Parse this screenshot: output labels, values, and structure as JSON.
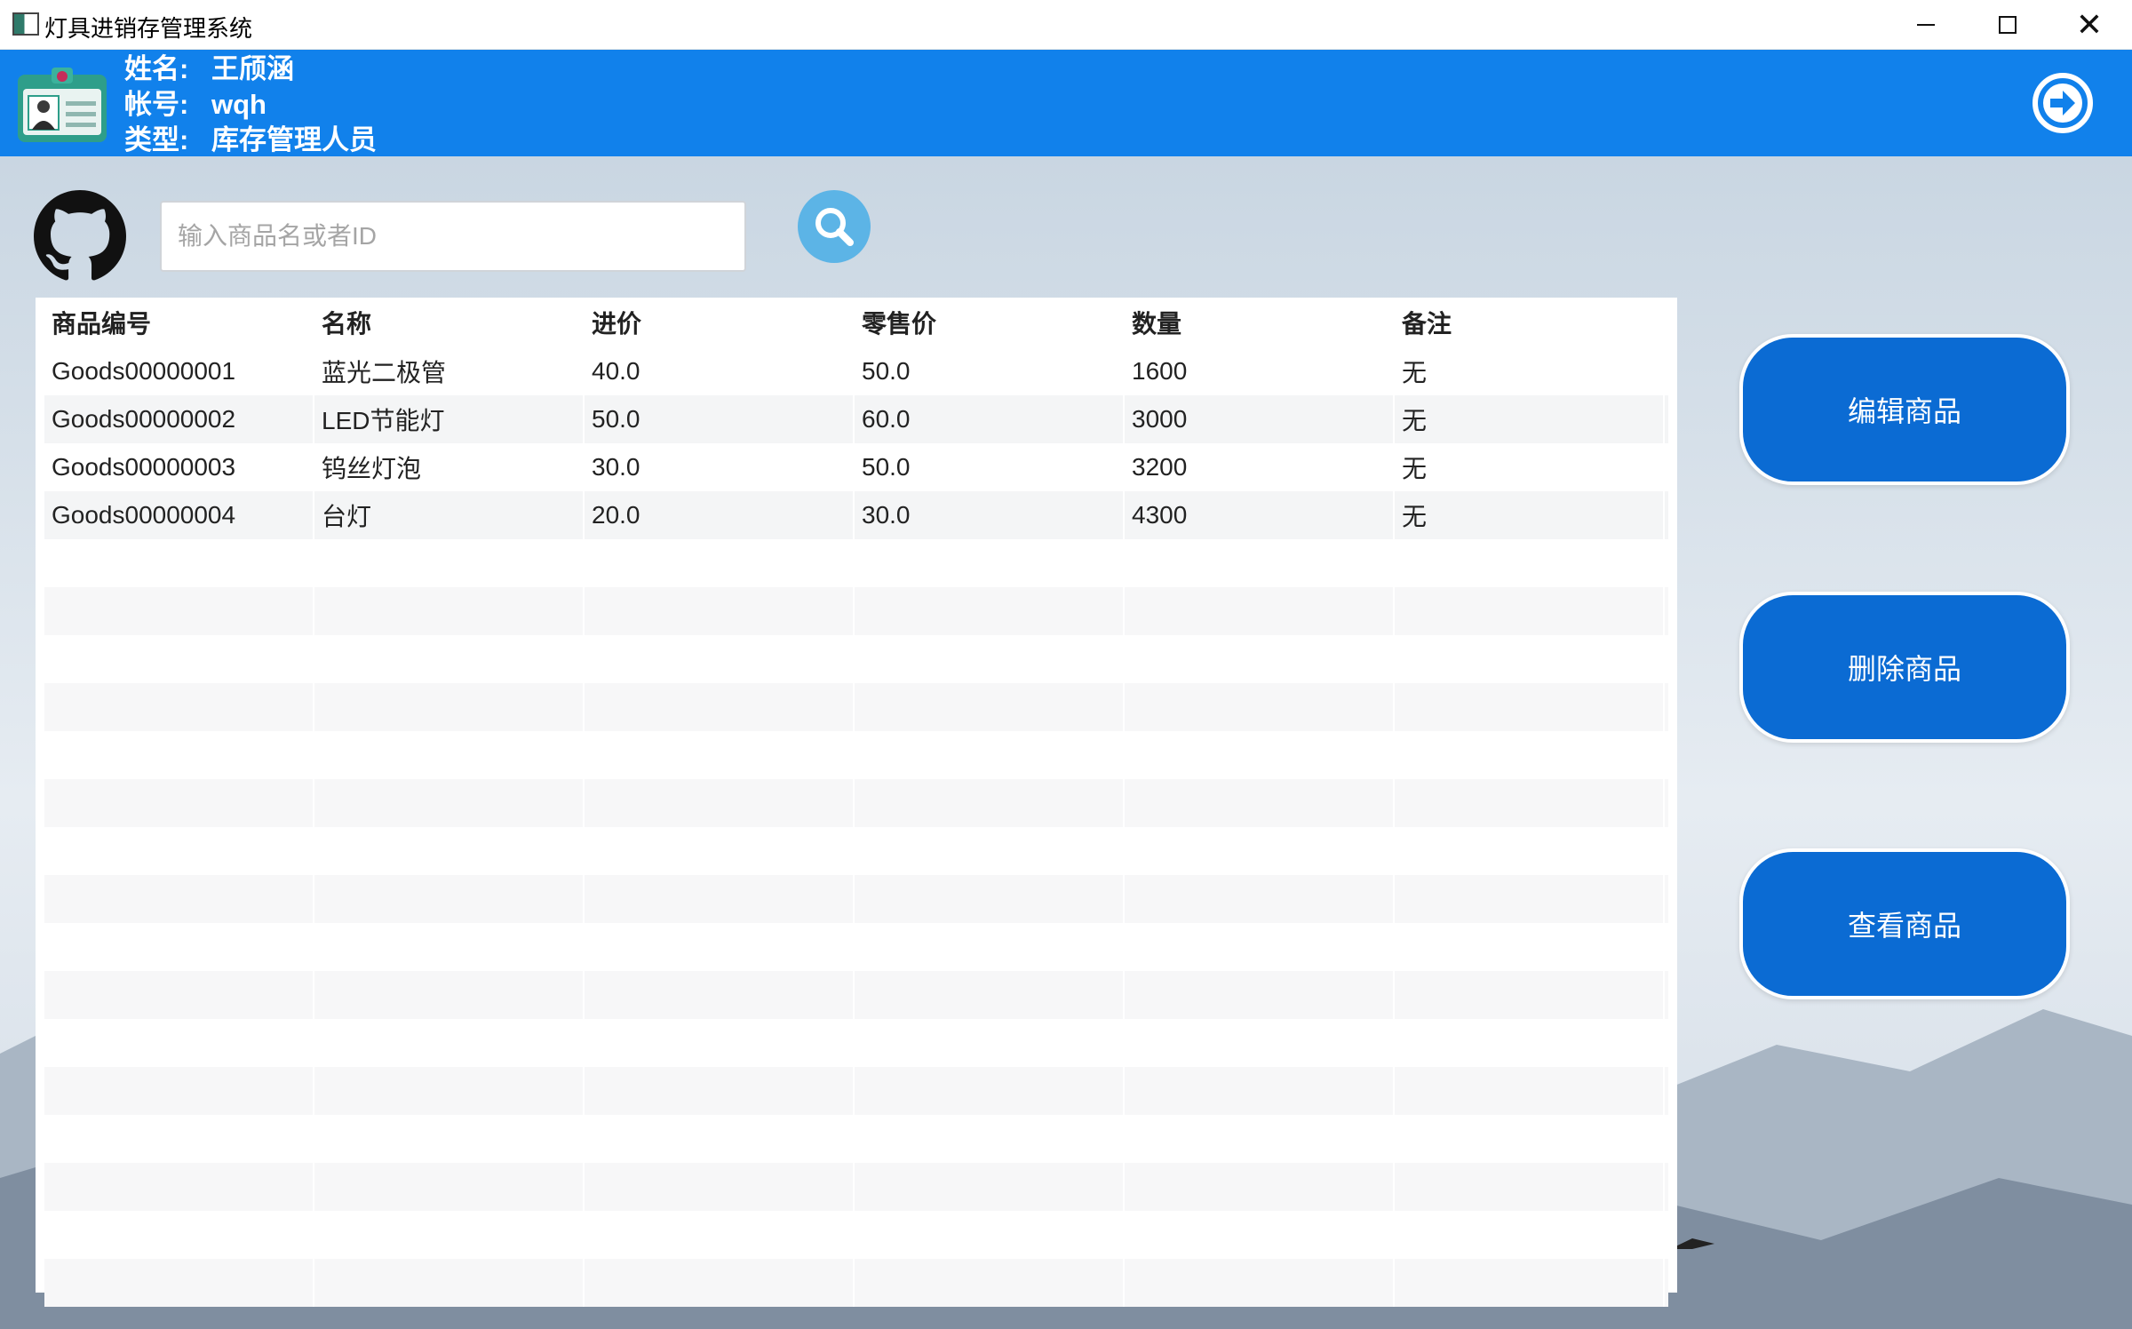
{
  "window": {
    "title": "灯具进销存管理系统"
  },
  "user": {
    "name_label": "姓名:",
    "name": "王颀涵",
    "account_label": "帐号:",
    "account": "wqh",
    "type_label": "类型:",
    "type": "库存管理人员"
  },
  "search": {
    "placeholder": "输入商品名或者ID",
    "value": ""
  },
  "table": {
    "columns": [
      "商品编号",
      "名称",
      "进价",
      "零售价",
      "数量",
      "备注"
    ],
    "rows": [
      [
        "Goods00000001",
        "蓝光二极管",
        "40.0",
        "50.0",
        "1600",
        "无"
      ],
      [
        "Goods00000002",
        "LED节能灯",
        "50.0",
        "60.0",
        "3000",
        "无"
      ],
      [
        "Goods00000003",
        "钨丝灯泡",
        "30.0",
        "50.0",
        "3200",
        "无"
      ],
      [
        "Goods00000004",
        "台灯",
        "20.0",
        "30.0",
        "4300",
        "无"
      ]
    ]
  },
  "actions": {
    "edit": "编辑商品",
    "delete": "删除商品",
    "view": "查看商品"
  },
  "icons": {
    "app": "app-window-icon",
    "id_card": "id-card-icon",
    "logout": "arrow-right-circle-icon",
    "github": "github-icon",
    "search": "search-icon"
  },
  "colors": {
    "header": "#1181eb",
    "button": "#0b6bd3",
    "search_button": "#5cb4e6"
  }
}
